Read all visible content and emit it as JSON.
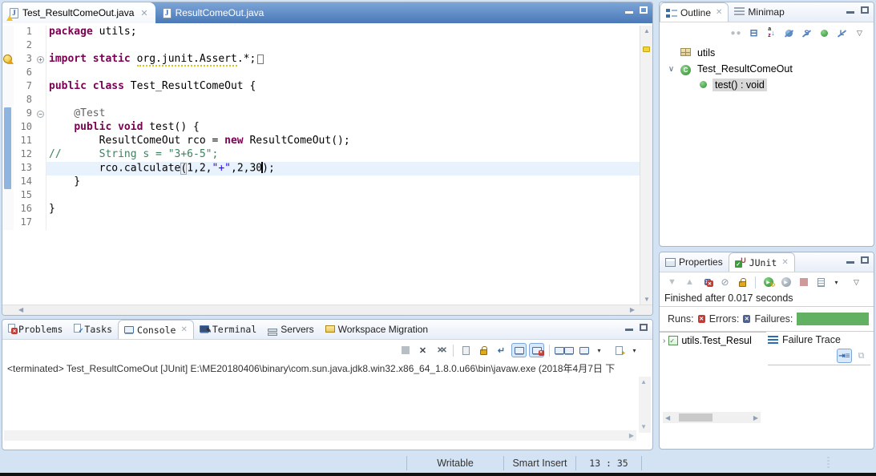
{
  "editor": {
    "tabs": [
      {
        "label": "Test_ResultComeOut.java",
        "active": true,
        "warning": true
      },
      {
        "label": "ResultComeOut.java",
        "active": false,
        "warning": false
      }
    ],
    "code_lines": [
      {
        "num": "1",
        "segs": [
          [
            "kw",
            "package"
          ],
          [
            "pl",
            " utils;"
          ]
        ]
      },
      {
        "num": "2",
        "segs": []
      },
      {
        "num": "3",
        "fold": "+",
        "margin": "warning",
        "segs": [
          [
            "kw",
            "import static"
          ],
          [
            "pl",
            " "
          ],
          [
            "und",
            "org.junit.Assert"
          ],
          [
            "pl",
            ".*;"
          ],
          [
            "box",
            ""
          ]
        ]
      },
      {
        "num": "6",
        "segs": []
      },
      {
        "num": "7",
        "segs": [
          [
            "kw",
            "public class"
          ],
          [
            "pl",
            " Test_ResultComeOut {"
          ]
        ]
      },
      {
        "num": "8",
        "segs": []
      },
      {
        "num": "9",
        "fold": "-",
        "range": "start",
        "segs": [
          [
            "ann",
            "    @Test"
          ]
        ]
      },
      {
        "num": "10",
        "range": "mid",
        "segs": [
          [
            "pl",
            "    "
          ],
          [
            "kw",
            "public void"
          ],
          [
            "pl",
            " test() {"
          ]
        ]
      },
      {
        "num": "11",
        "range": "mid",
        "segs": [
          [
            "pl",
            "        ResultComeOut rco = "
          ],
          [
            "kw",
            "new"
          ],
          [
            "pl",
            " ResultComeOut();"
          ]
        ]
      },
      {
        "num": "12",
        "range": "mid",
        "segs": [
          [
            "cm",
            "//      String s = \"3+6-5\";"
          ]
        ]
      },
      {
        "num": "13",
        "range": "mid",
        "current": true,
        "segs": [
          [
            "pl",
            "        rco.calculate"
          ],
          [
            "brk",
            "("
          ],
          [
            "pl",
            "1,2,"
          ],
          [
            "str",
            "\"+\""
          ],
          [
            "pl",
            ",2,30"
          ],
          [
            "caret",
            ""
          ],
          [
            "pl",
            ");"
          ]
        ]
      },
      {
        "num": "14",
        "range": "end",
        "segs": [
          [
            "pl",
            "    }"
          ]
        ]
      },
      {
        "num": "15",
        "segs": []
      },
      {
        "num": "16",
        "segs": [
          [
            "pl",
            "}"
          ]
        ]
      },
      {
        "num": "17",
        "segs": []
      }
    ]
  },
  "outline": {
    "tabs": [
      {
        "label": "Outline",
        "active": true
      },
      {
        "label": "Minimap",
        "active": false
      }
    ],
    "toolbar": [
      "focus-active-task-icon",
      "collapse-all-icon",
      "sort-icon",
      "hide-fields-icon",
      "hide-static-icon",
      "hide-non-public-icon",
      "hide-local-types-icon",
      "view-menu-icon"
    ],
    "tree": [
      {
        "icon": "package-icon",
        "label": "utils",
        "level": 0,
        "chevron": ""
      },
      {
        "icon": "class-icon",
        "label": "Test_ResultComeOut",
        "level": 0,
        "chevron": "expanded"
      },
      {
        "icon": "method-public-icon",
        "label": "test() : void",
        "level": 1,
        "chevron": "",
        "selected": true
      }
    ]
  },
  "junit": {
    "tabs": [
      {
        "label": "Properties",
        "active": false
      },
      {
        "label": "JUnit",
        "active": true
      }
    ],
    "toolbar": [
      "next-failed-test-icon",
      "previous-failed-test-icon",
      "show-failures-only-icon",
      "show-skipped-tests-icon",
      "scroll-lock-icon",
      "sep",
      "rerun-test-icon",
      "rerun-failed-first-icon",
      "stop-test-icon",
      "test-run-history-icon",
      "menu-arrow-icon",
      "view-menu-icon"
    ],
    "status_text": "Finished after 0.017 seconds",
    "runs_label": "Runs:",
    "errors_label": "Errors:",
    "failures_label": "Failures:",
    "success_color": "#62b162",
    "tree_item": "utils.Test_Resul",
    "failure_trace_label": "Failure Trace",
    "failure_trace_actions": [
      "filter-stack-trace-icon",
      "compare-result-icon"
    ]
  },
  "console": {
    "tabs": [
      {
        "label": "Problems",
        "icon": "problems-icon",
        "active": false
      },
      {
        "label": "Tasks",
        "icon": "tasks-icon",
        "active": false
      },
      {
        "label": "Console",
        "icon": "console-icon",
        "active": true
      },
      {
        "label": "Terminal",
        "icon": "terminal-icon",
        "active": false
      },
      {
        "label": "Servers",
        "icon": "servers-icon",
        "active": false
      },
      {
        "label": "Workspace Migration",
        "icon": "workspace-migration-icon",
        "active": false
      }
    ],
    "toolbar": [
      "terminate-icon",
      "remove-launch-icon",
      "remove-all-launches-icon",
      "sep",
      "clear-console-icon",
      "scroll-lock-icon",
      "word-wrap-icon",
      "show-stdout-icon",
      "show-stderr-icon",
      "sep",
      "pin-console-icon",
      "display-console-icon",
      "menu-arrow-icon",
      "open-console-icon",
      "menu-arrow-icon"
    ],
    "message": "<terminated> Test_ResultComeOut [JUnit] E:\\ME20180406\\binary\\com.sun.java.jdk8.win32.x86_64_1.8.0.u66\\bin\\javaw.exe (2018年4月7日 下"
  },
  "statusbar": {
    "writable": "Writable",
    "smart_insert": "Smart Insert",
    "position": "13 : 35"
  }
}
